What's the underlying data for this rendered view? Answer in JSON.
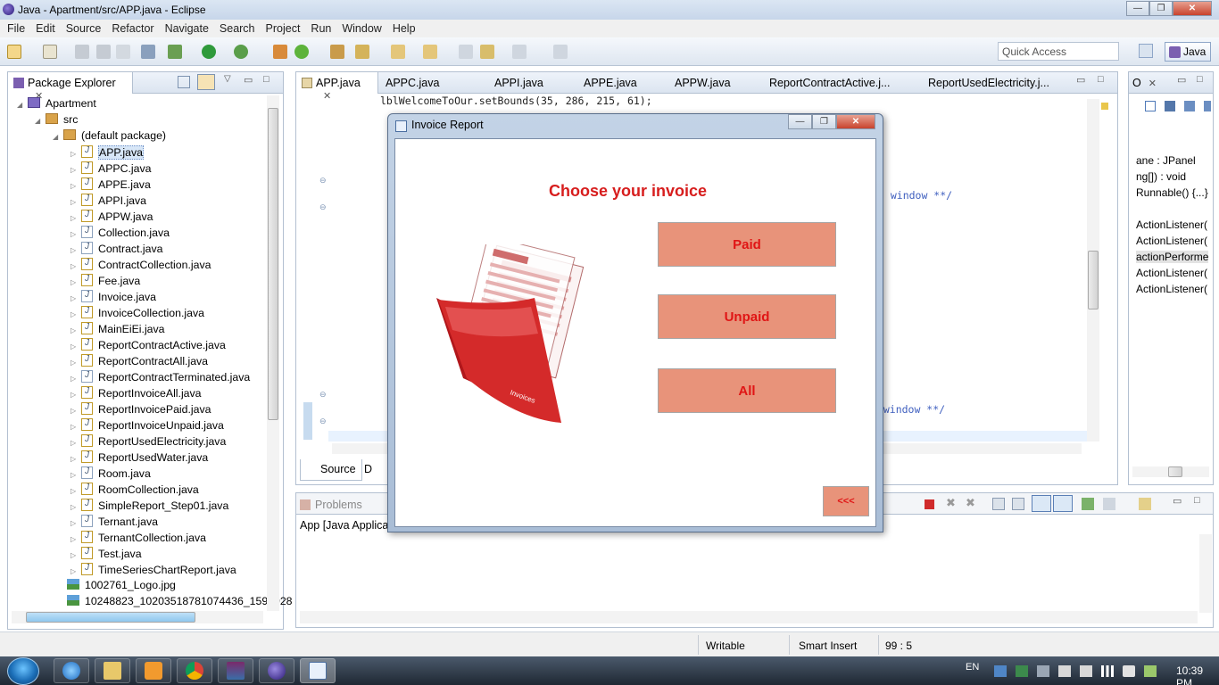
{
  "window": {
    "title": "Java - Apartment/src/APP.java - Eclipse"
  },
  "menu": [
    "File",
    "Edit",
    "Source",
    "Refactor",
    "Navigate",
    "Search",
    "Project",
    "Run",
    "Window",
    "Help"
  ],
  "quick_access": {
    "placeholder": "Quick Access"
  },
  "perspective": {
    "label": "Java"
  },
  "package_explorer": {
    "tab_label": "Package Explorer",
    "project": "Apartment",
    "src": "src",
    "package": "(default package)",
    "files": [
      "APP.java",
      "APPC.java",
      "APPE.java",
      "APPI.java",
      "APPW.java",
      "Collection.java",
      "Contract.java",
      "ContractCollection.java",
      "Fee.java",
      "Invoice.java",
      "InvoiceCollection.java",
      "MainEiEi.java",
      "ReportContractActive.java",
      "ReportContractAll.java",
      "ReportContractTerminated.java",
      "ReportInvoiceAll.java",
      "ReportInvoicePaid.java",
      "ReportInvoiceUnpaid.java",
      "ReportUsedElectricity.java",
      "ReportUsedWater.java",
      "Room.java",
      "RoomCollection.java",
      "SimpleReport_Step01.java",
      "Ternant.java",
      "TernantCollection.java",
      "Test.java",
      "TimeSeriesChartReport.java"
    ],
    "images": [
      "1002761_Logo.jpg",
      "10248823_10203518781074436_1599928"
    ]
  },
  "editor": {
    "tabs": [
      "APP.java",
      "APPC.java",
      "APPI.java",
      "APPE.java",
      "APPW.java",
      "ReportContractActive.j...",
      "ReportUsedElectricity.j..."
    ],
    "code_top": "lblWelcomeToOur.setBounds(35, 286, 215, 61);",
    "comment1": "t window **/",
    "comment2": "e window **/",
    "bottom_tabs": [
      "Source",
      "D"
    ]
  },
  "outline": {
    "tab_label": "O",
    "items": [
      "ane : JPanel",
      "ng[]) : void",
      "Runnable() {...}",
      "ActionListener(",
      "ActionListener(",
      "actionPerforme",
      "ActionListener(",
      "ActionListener("
    ]
  },
  "console": {
    "tab_label": "Problems",
    "text": "App [Java Applicat"
  },
  "dialog": {
    "title": "Invoice Report",
    "heading": "Choose your invoice",
    "buttons": {
      "paid": "Paid",
      "unpaid": "Unpaid",
      "all": "All",
      "back": "<<<"
    },
    "folder_label": "Invoices"
  },
  "status": {
    "writable": "Writable",
    "insert": "Smart Insert",
    "position": "99 : 5"
  },
  "taskbar": {
    "lang": "EN",
    "clock": "10:39 PM"
  }
}
